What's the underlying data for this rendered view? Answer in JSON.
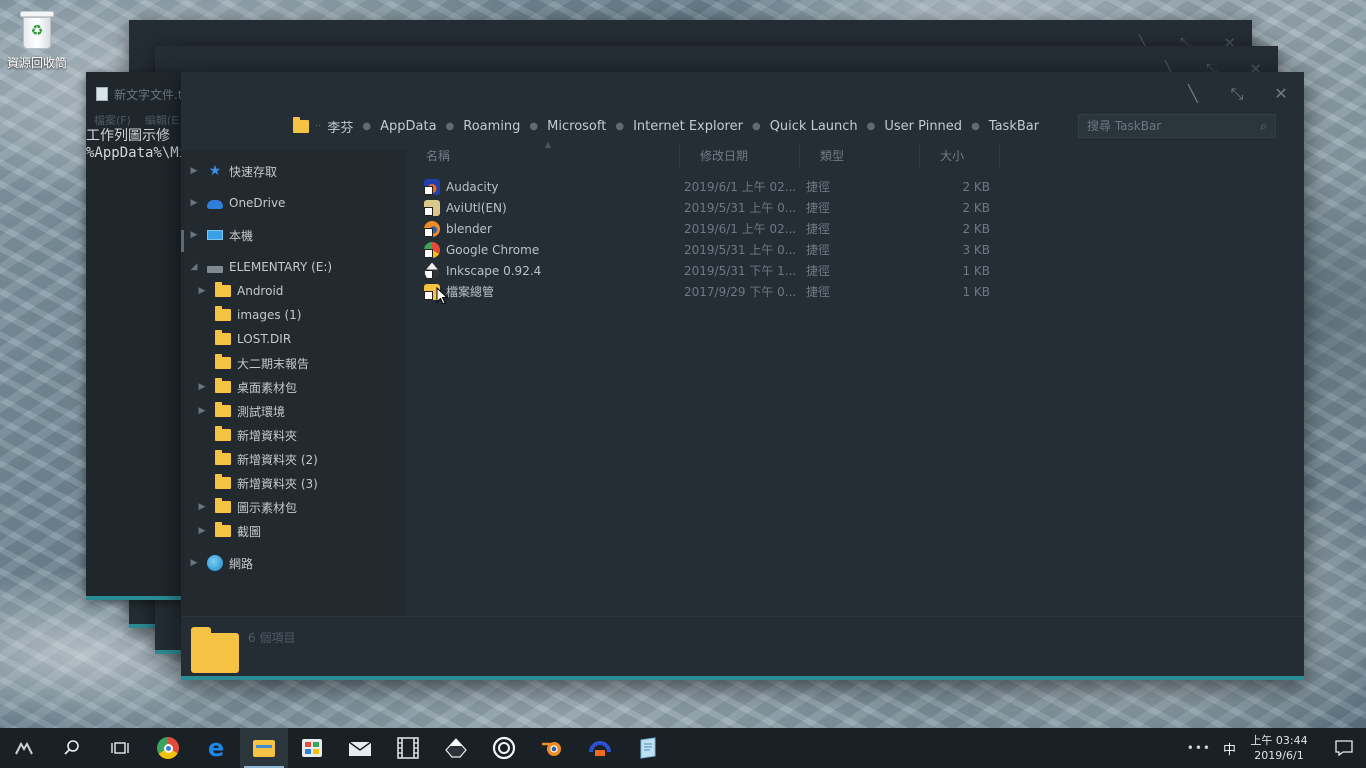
{
  "desktop": {
    "recycle_bin_label": "資源回收筒"
  },
  "notepad": {
    "title": "新文字文件.t",
    "menu": [
      "檔案(F)",
      "編輯(E"
    ],
    "lines": [
      "工作列圖示修",
      "%AppData%\\Mi"
    ]
  },
  "explorer": {
    "breadcrumb": [
      "李芬",
      "AppData",
      "Roaming",
      "Microsoft",
      "Internet Explorer",
      "Quick Launch",
      "User Pinned",
      "TaskBar"
    ],
    "breadcrumb_overflow": "··",
    "search_placeholder": "搜尋 TaskBar",
    "nav": {
      "quick_access": "快速存取",
      "onedrive": "OneDrive",
      "this_pc": "本機",
      "drive": "ELEMENTARY (E:)",
      "folders": [
        "Android",
        "images (1)",
        "LOST.DIR",
        "大二期末報告",
        "桌面素材包",
        "測試環境",
        "新增資料夾",
        "新增資料夾 (2)",
        "新增資料夾 (3)",
        "圖示素材包",
        "截圖"
      ],
      "network": "網路"
    },
    "columns": {
      "name": "名稱",
      "modified": "修改日期",
      "type": "類型",
      "size": "大小"
    },
    "files": [
      {
        "name": "Audacity",
        "modified": "2019/6/1 上午 02...",
        "type": "捷徑",
        "size": "2 KB",
        "icon": "audacity-icon",
        "color": "#1f3fae"
      },
      {
        "name": "AviUtl(EN)",
        "modified": "2019/5/31 上午 0...",
        "type": "捷徑",
        "size": "2 KB",
        "icon": "aviutl-icon",
        "color": "#d9c98a"
      },
      {
        "name": "blender",
        "modified": "2019/6/1 上午 02...",
        "type": "捷徑",
        "size": "2 KB",
        "icon": "blender-icon",
        "color": "#f08c23"
      },
      {
        "name": "Google Chrome",
        "modified": "2019/5/31 上午 0...",
        "type": "捷徑",
        "size": "3 KB",
        "icon": "chrome-icon",
        "color": "#e44b3c"
      },
      {
        "name": "Inkscape 0.92.4",
        "modified": "2019/5/31 下午 1...",
        "type": "捷徑",
        "size": "1 KB",
        "icon": "inkscape-icon",
        "color": "#333333"
      },
      {
        "name": "檔案總管",
        "modified": "2017/9/29 下午 0...",
        "type": "捷徑",
        "size": "1 KB",
        "icon": "file-explorer-icon",
        "color": "#f5c244"
      }
    ],
    "status": "6 個項目"
  },
  "taskbar": {
    "apps": [
      "start-icon",
      "search-icon",
      "task-view-icon",
      "chrome-icon",
      "edge-icon",
      "file-explorer-icon",
      "store-icon",
      "mail-icon",
      "film-icon",
      "inkscape-icon",
      "obs-icon",
      "blender-icon",
      "audacity-icon",
      "notepad-icon"
    ],
    "ime": "中",
    "time": "上午 03:44",
    "date": "2019/6/1"
  },
  "colors": {
    "accent": "#2a8c94",
    "folder": "#f5c244",
    "window_bg": "#252e35"
  }
}
